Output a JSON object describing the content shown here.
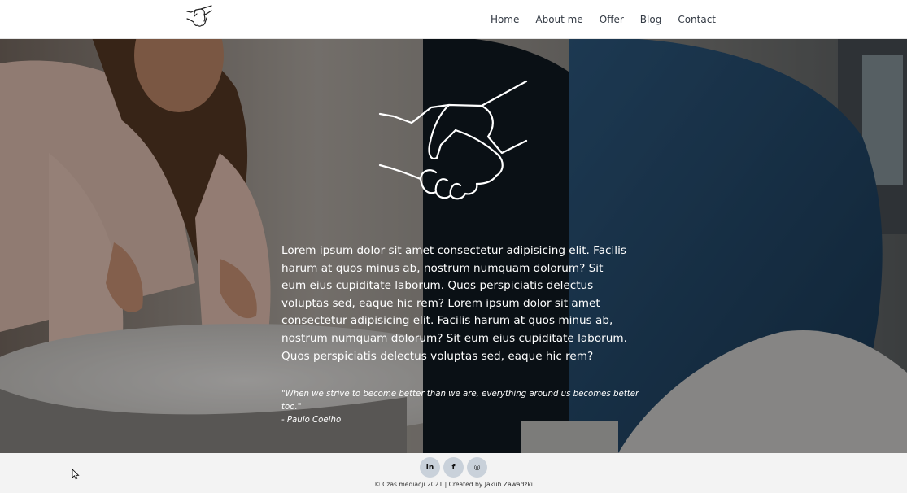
{
  "header": {
    "logo_icon": "handshake-icon",
    "nav": [
      {
        "label": "Home"
      },
      {
        "label": "About me"
      },
      {
        "label": "Offer"
      },
      {
        "label": "Blog"
      },
      {
        "label": "Contact"
      }
    ]
  },
  "hero": {
    "background": "photo of two people talking at a white table",
    "emblem_icon": "handshake-icon",
    "text": "Lorem ipsum dolor sit amet consectetur adipisicing elit. Facilis harum at quos minus ab, nostrum numquam dolorum? Sit eum eius cupiditate laborum. Quos perspiciatis delectus voluptas sed, eaque hic rem? Lorem ipsum dolor sit amet consectetur adipisicing elit. Facilis harum at quos minus ab, nostrum numquam dolorum? Sit eum eius cupiditate laborum. Quos perspiciatis delectus voluptas sed, eaque hic rem?",
    "quote": "\"When we strive to become better than we are, everything around us becomes better too.\"",
    "quote_author": "- Paulo Coelho"
  },
  "footer": {
    "socials": [
      {
        "icon": "linkedin-icon",
        "label": "in"
      },
      {
        "icon": "facebook-icon",
        "label": "f"
      },
      {
        "icon": "instagram-icon",
        "label": "◎"
      }
    ],
    "copyright": "© Czas mediacji 2021 | Created by Jakub Zawadzki"
  },
  "colors": {
    "nav_text": "#333a44",
    "social_bg": "#c9d1da",
    "footer_bg": "#f3f3f3"
  }
}
